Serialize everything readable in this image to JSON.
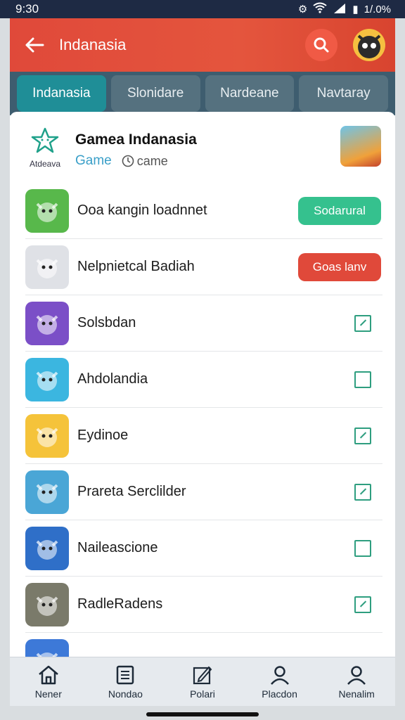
{
  "status": {
    "time": "9:30",
    "battery": "1/.0%"
  },
  "app_bar": {
    "title": "Indanasia"
  },
  "tabs": [
    {
      "label": "Indanasia",
      "active": true
    },
    {
      "label": "Slonidare",
      "active": false
    },
    {
      "label": "Nardeane",
      "active": false
    },
    {
      "label": "Navtaray",
      "active": false
    }
  ],
  "header": {
    "logo_caption": "Atdeava",
    "title": "Gamea Indanasia",
    "game_label": "Game",
    "meta": "came"
  },
  "rows": [
    {
      "label": "Ooa kangin loadnnet",
      "action": "Sodarural",
      "action_type": "green",
      "icon_color": "#58b84b",
      "icon_name": "cat-game-icon"
    },
    {
      "label": "Nelpnietcal Badiah",
      "action": "Goas lanv",
      "action_type": "red",
      "icon_color": "#dfe1e6",
      "icon_name": "capsule-icon"
    },
    {
      "label": "Solsbdan",
      "checked": true,
      "icon_color": "#7b4fc7",
      "icon_name": "ninja-game-icon"
    },
    {
      "label": "Ahdolandia",
      "checked": false,
      "icon_color": "#3bb6e0",
      "icon_name": "fox-game-icon"
    },
    {
      "label": "Eydinoe",
      "checked": true,
      "icon_color": "#f5c33a",
      "icon_name": "dragon-game-icon"
    },
    {
      "label": "Prareta Serclilder",
      "checked": true,
      "icon_color": "#4aa6d6",
      "icon_name": "adventurer-game-icon"
    },
    {
      "label": "Naileascione",
      "checked": false,
      "icon_color": "#2f6fc8",
      "icon_name": "wizard-game-icon"
    },
    {
      "label": "RadleRadens",
      "checked": true,
      "icon_color": "#7a7a6a",
      "icon_name": "golden-beast-game-icon"
    },
    {
      "label": "",
      "checked": false,
      "icon_color": "#3d79d8",
      "icon_name": "partial-game-icon"
    }
  ],
  "bottom_nav": [
    {
      "label": "Nener",
      "icon": "home-icon"
    },
    {
      "label": "Nondao",
      "icon": "news-icon"
    },
    {
      "label": "Polari",
      "icon": "edit-icon"
    },
    {
      "label": "Placdon",
      "icon": "profile-icon"
    },
    {
      "label": "Nenalim",
      "icon": "account-icon"
    }
  ]
}
